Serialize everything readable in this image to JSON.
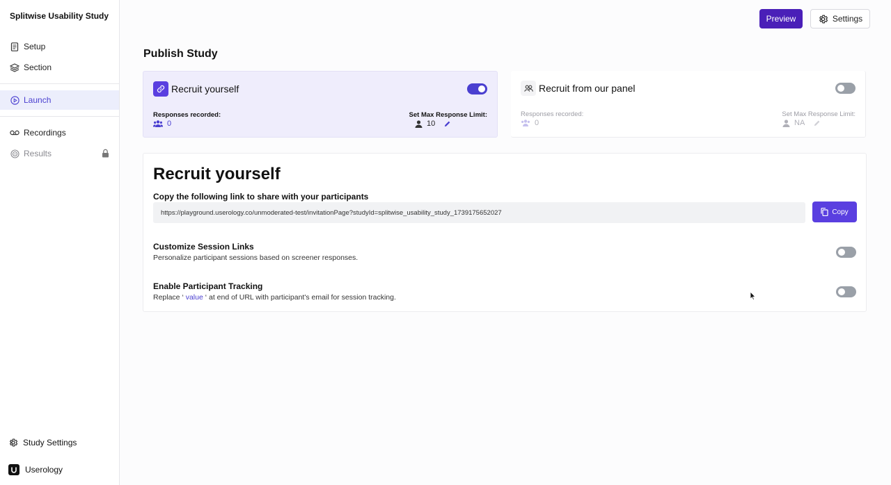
{
  "sidebar": {
    "study_title": "Splitwise Usability Study",
    "items": [
      {
        "label": "Setup",
        "icon": "document-icon"
      },
      {
        "label": "Section",
        "icon": "layers-icon"
      },
      {
        "label": "Launch",
        "icon": "play-circle-icon",
        "active": true
      },
      {
        "label": "Recordings",
        "icon": "voicemail-icon"
      },
      {
        "label": "Results",
        "icon": "target-icon",
        "locked": true
      }
    ],
    "study_settings": "Study Settings",
    "brand": "Userology"
  },
  "header": {
    "preview_label": "Preview",
    "settings_label": "Settings"
  },
  "page_title": "Publish Study",
  "cards": {
    "self": {
      "title": "Recruit yourself",
      "enabled": true,
      "responses_label": "Responses recorded:",
      "responses_value": "0",
      "limit_label": "Set Max Response Limit:",
      "limit_value": "10"
    },
    "panel": {
      "title": "Recruit from our panel",
      "enabled": false,
      "responses_label": "Responses recorded:",
      "responses_value": "0",
      "limit_label": "Set Max Response Limit:",
      "limit_value": "NA"
    }
  },
  "recruit_section": {
    "title": "Recruit yourself",
    "share_label": "Copy the following link to share with your participants",
    "url": "https://playground.userology.co/unmoderated-test/invitationPage?studyId=splitwise_usability_study_1739175652027",
    "copy_label": "Copy",
    "options": [
      {
        "title": "Customize Session Links",
        "description": "Personalize participant sessions based on screener responses.",
        "enabled": false
      },
      {
        "title": "Enable Participant Tracking",
        "desc_pre": "Replace ‘ ",
        "desc_value": "value",
        "desc_post": " ‘ at end of URL with participant's email for session tracking.",
        "enabled": false
      }
    ]
  },
  "colors": {
    "accent": "#4a3fd0",
    "preview_bg": "#4a1fb8",
    "card_active_bg": "#efedfc"
  }
}
